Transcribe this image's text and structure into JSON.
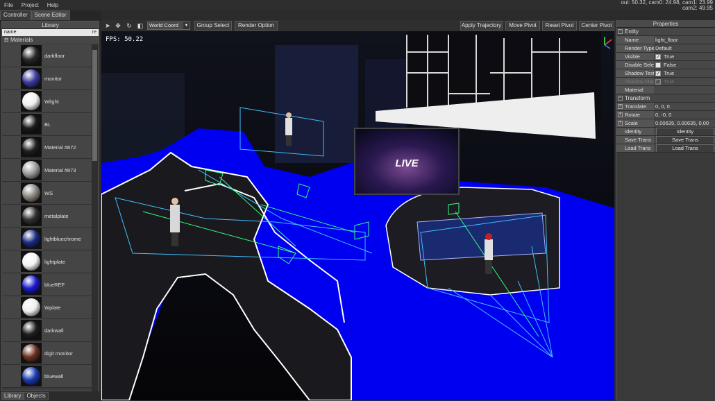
{
  "menu": [
    "File",
    "Project",
    "Help"
  ],
  "status": {
    "line1": "out: 50.32, cam0: 24.98, cam1: 23.99",
    "line2": "cam2: 49.95"
  },
  "tabs": {
    "controller": "Controller",
    "scene_editor": "Scene Editor"
  },
  "library": {
    "title": "Library",
    "column": "name",
    "group": "Materials",
    "items": [
      {
        "name": "darkfloor",
        "color": "#2a2a2a"
      },
      {
        "name": "monitor",
        "color": "#3a3aa0"
      },
      {
        "name": "Wlight",
        "color": "#f0f0f0"
      },
      {
        "name": "BL",
        "color": "#1a1a1a"
      },
      {
        "name": "Material #872",
        "color": "#202020"
      },
      {
        "name": "Material #873",
        "color": "#9a9a9a"
      },
      {
        "name": "WS",
        "color": "#8a8580"
      },
      {
        "name": "metalplate",
        "color": "#303030"
      },
      {
        "name": "lightbluechrome",
        "color": "#1a2a80"
      },
      {
        "name": "lightplate",
        "color": "#f4f4f4"
      },
      {
        "name": "blueREF",
        "color": "#1a1ad0"
      },
      {
        "name": "Wplate",
        "color": "#eeeeee"
      },
      {
        "name": "darkwall",
        "color": "#1e1e1e"
      },
      {
        "name": "digit monitor",
        "color": "#6a3020"
      },
      {
        "name": "bluewall",
        "color": "#1a3ab0"
      }
    ],
    "bottom_tabs": [
      "Library",
      "Objects"
    ]
  },
  "toolbar": {
    "coord": "World Coord",
    "group_select": "Group Select",
    "render_option": "Render Option",
    "apply_trajectory": "Apply Trajectory",
    "move_pivot": "Move Pivot",
    "reset_pivot": "Reset Pivot",
    "center_pivot": "Center Pivot"
  },
  "viewport": {
    "fps": "FPS: 50.22",
    "screen_text": "LIVE"
  },
  "properties": {
    "title": "Properties",
    "entity_section": "Entity",
    "name_label": "Name",
    "name_value": "light_floor",
    "render_type_label": "Render Type",
    "render_type_value": "Default",
    "visible_label": "Visible",
    "visible_value": "True",
    "disable_select_label": "Disable Select",
    "disable_select_value": "False",
    "shadow_test_label": "Shadow Test",
    "shadow_test_value": "True",
    "shadow_map_label": "Shadow Map",
    "shadow_map_value": "True",
    "material_label": "Material",
    "transform_section": "Transform",
    "translate_label": "Translate",
    "translate_value": "0, 0, 0",
    "rotate_label": "Rotate",
    "rotate_value": "0, -0, 0",
    "scale_label": "Scale",
    "scale_value": "0.00635, 0.00635, 0.00",
    "identity_label": "Identity",
    "identity_button": "Identity",
    "save_trans_label": "Save Trans",
    "save_trans_button": "Save Trans",
    "load_trans_label": "Load Trans",
    "load_trans_button": "Load Trans"
  },
  "colors": {
    "floor_blue": "#0000f0",
    "wire_cyan": "#40c0ff",
    "wire_green": "#30ff80"
  }
}
